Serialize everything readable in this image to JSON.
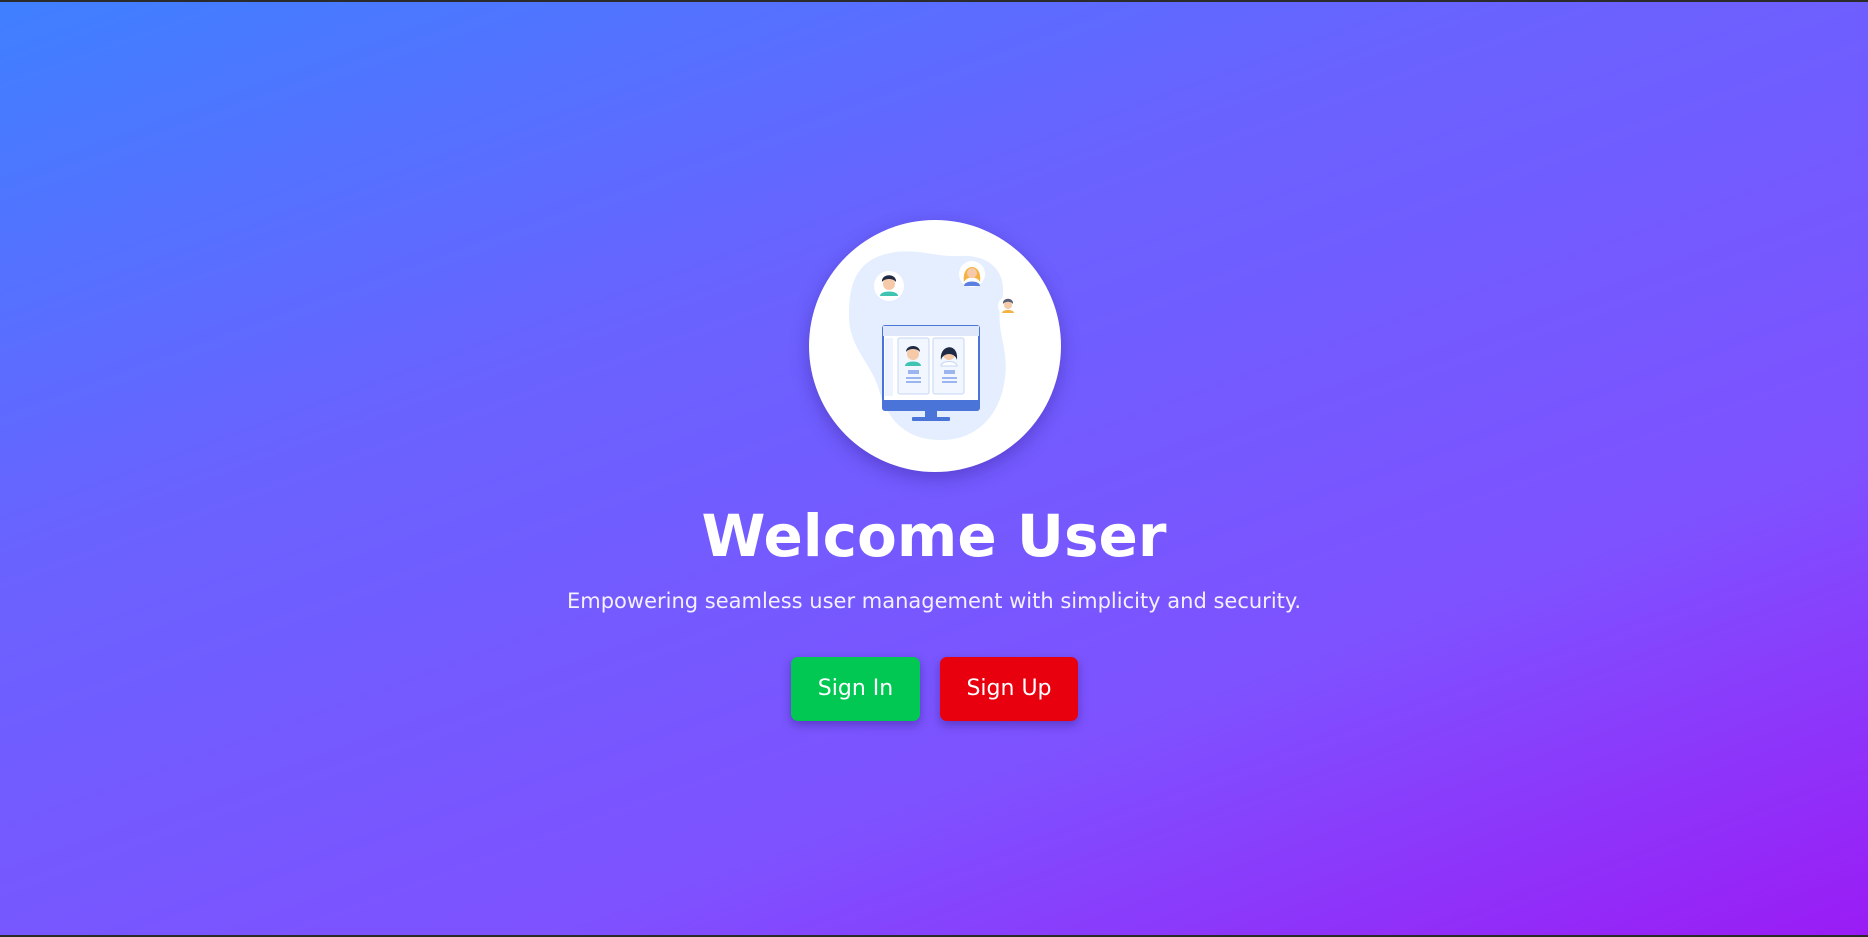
{
  "hero": {
    "illustration_icon": "user-management-illustration-icon",
    "title": "Welcome User",
    "subtitle": "Empowering seamless user management with simplicity and security."
  },
  "actions": {
    "sign_in_label": "Sign In",
    "sign_up_label": "Sign Up"
  },
  "colors": {
    "gradient_start": "#3f80ff",
    "gradient_end": "#9a1cf5",
    "sign_in_button": "#00c853",
    "sign_up_button": "#e8000f"
  }
}
